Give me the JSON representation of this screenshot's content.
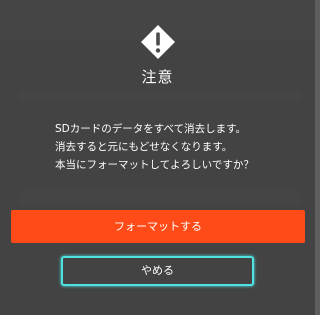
{
  "dialog": {
    "icon": "warning-icon",
    "title": "注意",
    "message_lines": [
      "SDカードのデータをすべて消去します。",
      "消去すると元にもどせなくなります。",
      "本当にフォーマットしてよろしいですか？"
    ],
    "confirm_label": "フォーマットする",
    "cancel_label": "やめる"
  },
  "colors": {
    "confirm_button": "#ff4b17",
    "cancel_focus_outline": "#4ee3e0",
    "cancel_button": "#434343",
    "overlay": "#3a3a3a"
  }
}
